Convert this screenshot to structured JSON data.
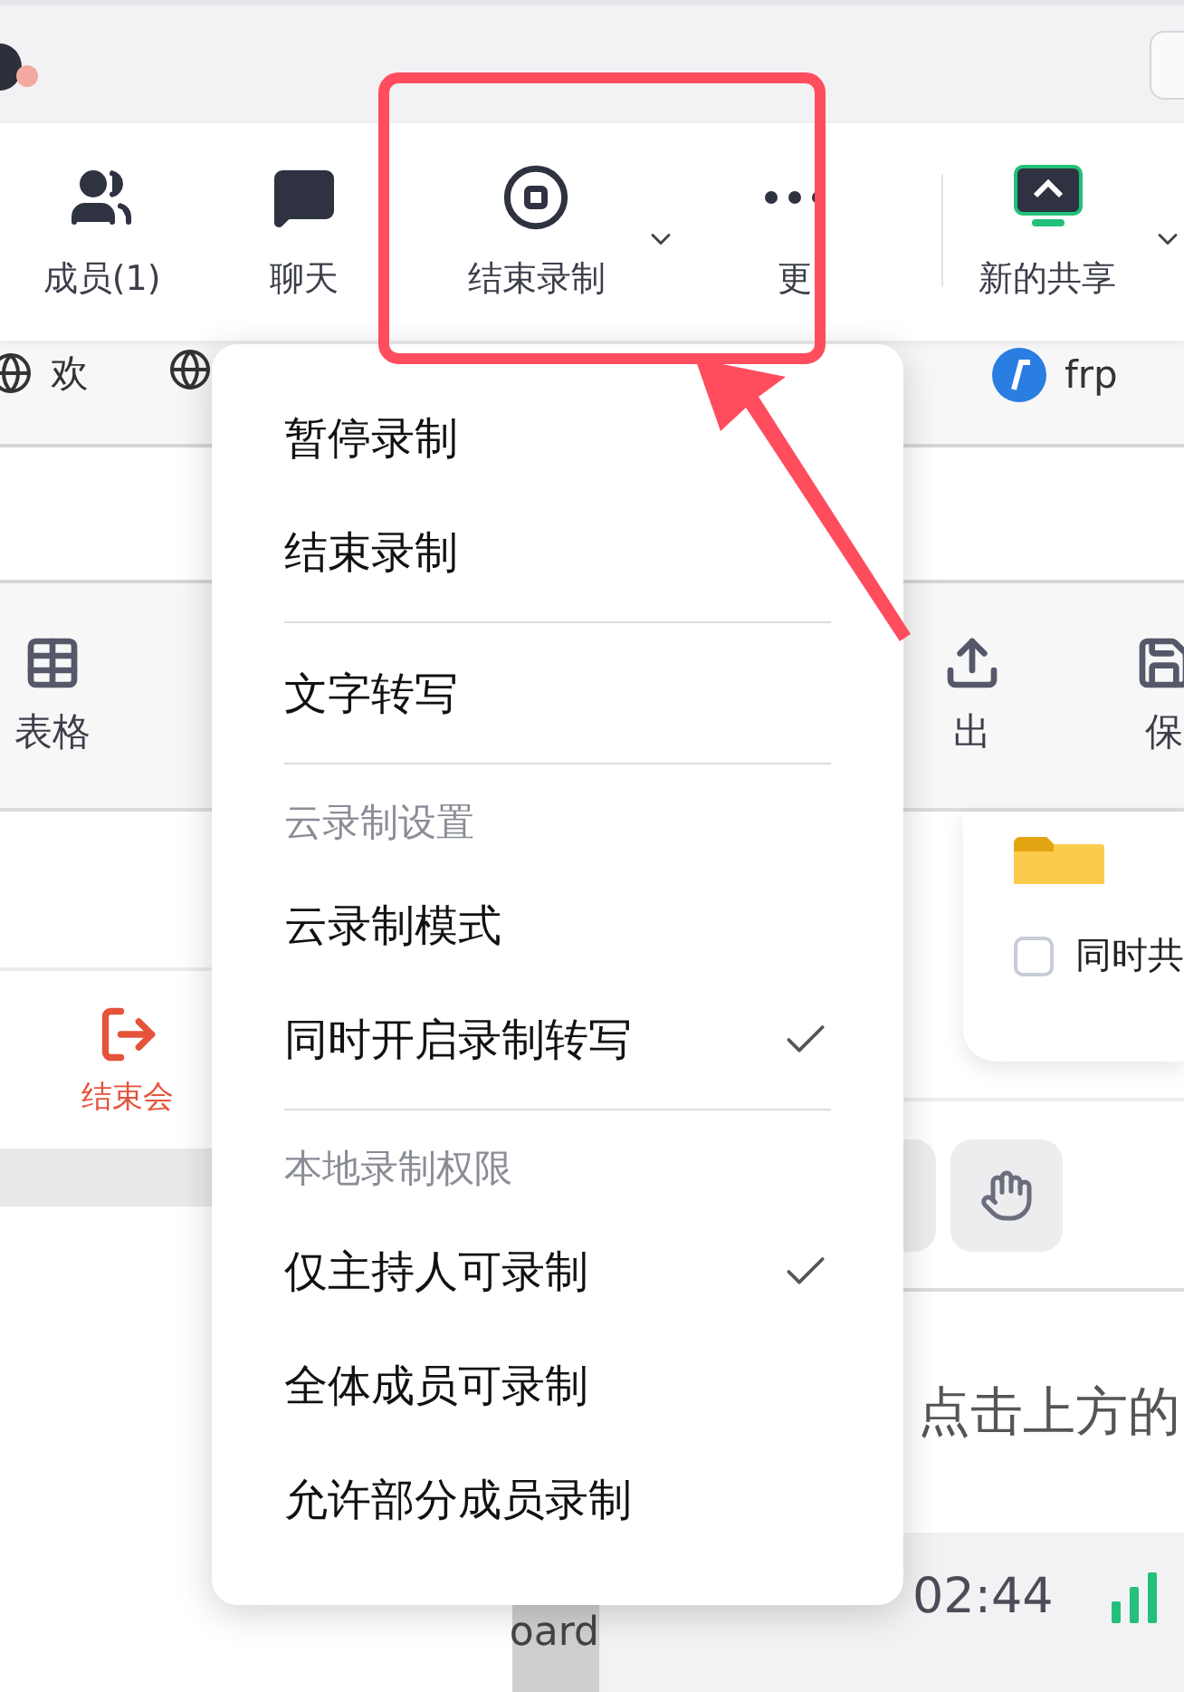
{
  "toolbar": {
    "items": [
      {
        "label": "成员(1)",
        "kind": "members",
        "has_menu": false
      },
      {
        "label": "聊天",
        "kind": "chat",
        "has_menu": false
      },
      {
        "label": "结束录制",
        "kind": "stop",
        "has_menu": true
      },
      {
        "label": "更",
        "kind": "more",
        "has_menu": false
      },
      {
        "label": "新的共享",
        "kind": "share",
        "has_menu": true
      }
    ]
  },
  "bookmarks": [
    {
      "label": "欢",
      "kind": "globe"
    },
    {
      "kind": "globe"
    },
    {
      "label": "frp",
      "kind": "frp"
    }
  ],
  "edit_toolbar": [
    {
      "label": "表格",
      "kind": "table"
    },
    {
      "label": "出",
      "kind": "export"
    },
    {
      "label": "保",
      "kind": "save"
    }
  ],
  "meeting_actions": [
    {
      "label": "结束会",
      "kind": "leave"
    }
  ],
  "card": {
    "checkbox": {
      "label": "同时共",
      "checked": false
    }
  },
  "hint": "点击上方的",
  "sidebar_note": "oard",
  "status_bar": {
    "time": "02:44"
  },
  "record_menu": [
    {
      "kind": "item",
      "label": "暂停录制",
      "checked": false
    },
    {
      "kind": "item",
      "label": "结束录制",
      "checked": false
    },
    {
      "kind": "divider"
    },
    {
      "kind": "item",
      "label": "文字转写",
      "checked": false
    },
    {
      "kind": "divider"
    },
    {
      "kind": "header",
      "label": "云录制设置"
    },
    {
      "kind": "item",
      "label": "云录制模式",
      "checked": false
    },
    {
      "kind": "item",
      "label": "同时开启录制转写",
      "checked": true
    },
    {
      "kind": "divider"
    },
    {
      "kind": "header",
      "label": "本地录制权限"
    },
    {
      "kind": "item",
      "label": "仅主持人可录制",
      "checked": true
    },
    {
      "kind": "item",
      "label": "全体成员可录制",
      "checked": false
    },
    {
      "kind": "item",
      "label": "允许部分成员录制",
      "checked": false
    }
  ]
}
